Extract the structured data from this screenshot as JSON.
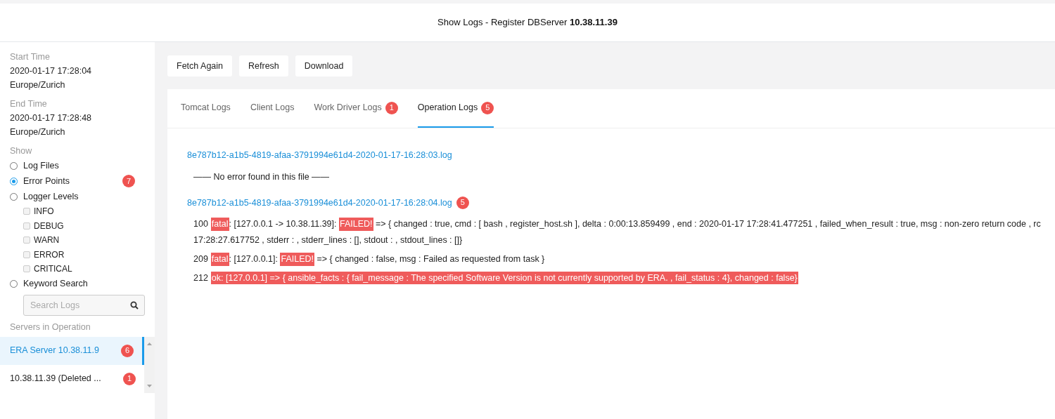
{
  "title": "Show Logs - Register DBServer **10.38.11.39**",
  "sidebar": {
    "start_label": "Start Time",
    "start_time": "2020-01-17 17:28:04",
    "start_zone": "Europe/Zurich",
    "end_label": "End Time",
    "end_time": "2020-01-17 17:28:48",
    "end_zone": "Europe/Zurich",
    "show_label": "Show",
    "options": [
      {
        "label": "Log Files",
        "selected": false
      },
      {
        "label": "Error Points",
        "selected": true,
        "badge": "7"
      },
      {
        "label": "Logger Levels",
        "selected": false,
        "levels": [
          {
            "label": "INFO",
            "checked": false
          },
          {
            "label": "DEBUG",
            "checked": false
          },
          {
            "label": "WARN",
            "checked": false
          },
          {
            "label": "ERROR",
            "checked": false
          },
          {
            "label": "CRITICAL",
            "checked": false
          }
        ]
      },
      {
        "label": "Keyword Search",
        "selected": false,
        "search_placeholder": "Search Logs"
      }
    ],
    "servers_label": "Servers in Operation",
    "servers": [
      {
        "name": "ERA Server 10.38.11.9",
        "badge": "6",
        "selected": true
      },
      {
        "name": "10.38.11.39 (Deleted ...",
        "badge": "1",
        "selected": false
      }
    ]
  },
  "buttons": [
    "Fetch Again",
    "Refresh",
    "Download"
  ],
  "tabs": [
    {
      "label": "Tomcat Logs",
      "selected": false
    },
    {
      "label": "Client Logs",
      "selected": false
    },
    {
      "label": "Work Driver Logs",
      "badge": "1",
      "selected": false
    },
    {
      "label": "Operation Logs",
      "badge": "5",
      "selected": true
    }
  ],
  "files": [
    {
      "name": "8e787b12-a1b5-4819-afaa-3791994e61d4-2020-01-17-16:28:03.log",
      "empty_message": "—— No error found in this file ——"
    },
    {
      "name": "8e787b12-a1b5-4819-afaa-3791994e61d4-2020-01-17-16:28:04.log",
      "badge": "5",
      "lines": [
        {
          "number": "100",
          "parts": [
            {
              "kind": "tag",
              "text": "fatal"
            },
            {
              "kind": "plain",
              "text": ": [127.0.0.1 -> 10.38.11.39]: "
            },
            {
              "kind": "tag",
              "text": "FAILED!"
            },
            {
              "kind": "plain",
              "text": " => { changed : true, cmd : [ bash , register_host.sh ], delta : 0:00:13.859499 , end : 2020-01-17 17:28:41.477251 , failed_when_result : true, msg : non-zero return code , rc"
            }
          ],
          "continuation": "17:28:27.617752 , stderr : , stderr_lines : [], stdout : , stdout_lines : []}"
        },
        {
          "number": "209",
          "parts": [
            {
              "kind": "tag",
              "text": "fatal"
            },
            {
              "kind": "plain",
              "text": ": [127.0.0.1]: "
            },
            {
              "kind": "tag",
              "text": "FAILED!"
            },
            {
              "kind": "plain",
              "text": " => { changed : false, msg : Failed as requested from task }"
            }
          ]
        },
        {
          "number": "212",
          "parts": [
            {
              "kind": "tag",
              "text": "ok: [127.0.0.1] => { ansible_facts : { fail_message : The specified Software Version is not currently supported by ERA. , fail_status : 4}, changed : false}"
            }
          ]
        }
      ]
    }
  ]
}
